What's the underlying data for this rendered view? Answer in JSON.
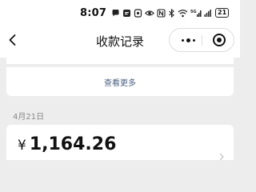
{
  "status_bar": {
    "time": "8:07",
    "icons": [
      "chat-bubble-icon",
      "message-icon",
      "notification-icon",
      "eye-comfort-icon",
      "nfc-icon",
      "bluetooth-icon",
      "wifi-icon",
      "signal-5g-icon",
      "signal-icon"
    ],
    "battery": "21"
  },
  "nav": {
    "title": "收款记录",
    "back_icon": "chevron-left-icon",
    "more_icon": "more-dots-icon",
    "close_icon": "target-close-icon"
  },
  "list": {
    "more_link": "查看更多",
    "groups": [
      {
        "date": "4月21日",
        "records": [
          {
            "currency": "¥",
            "amount": "1,164.26"
          }
        ]
      }
    ]
  },
  "colors": {
    "page_background": "#ededed",
    "card_background": "#ffffff",
    "link": "#4a5e80",
    "secondary_text": "#8a8a8a"
  }
}
